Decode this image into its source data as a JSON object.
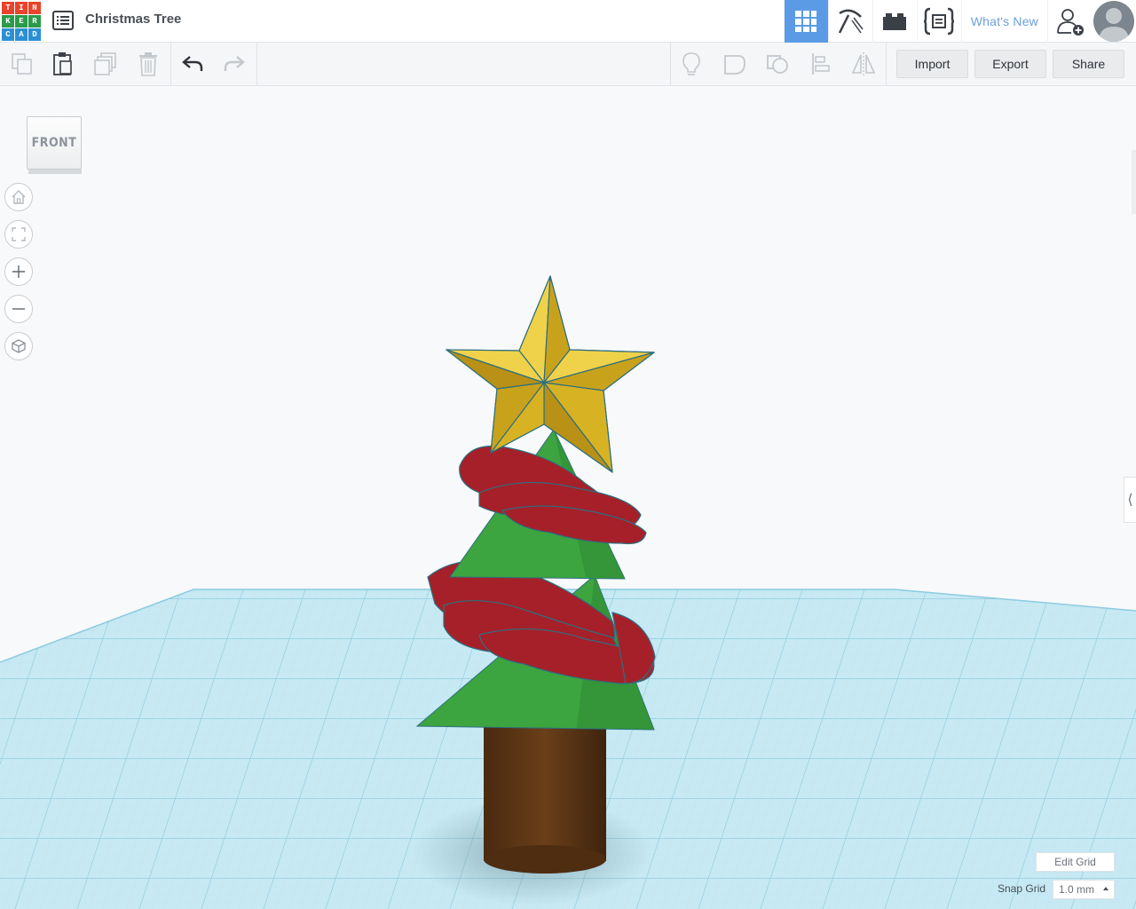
{
  "app": {
    "logo_letters": [
      "T",
      "I",
      "N",
      "K",
      "E",
      "R",
      "C",
      "A",
      "D"
    ],
    "logo_colors": [
      "#e9432b",
      "#e9432b",
      "#e9432b",
      "#2b9b4a",
      "#2b9b4a",
      "#2b9b4a",
      "#2b8fd6",
      "#2b8fd6",
      "#2b8fd6"
    ],
    "document_title": "Christmas Tree"
  },
  "nav": {
    "views": [
      {
        "icon": "grid-3d-design-icon",
        "active": true
      },
      {
        "icon": "pickaxe-blocks-icon",
        "active": false
      },
      {
        "icon": "bricks-icon",
        "active": false
      },
      {
        "icon": "codeblocks-icon",
        "active": false
      }
    ],
    "whats_new": "What's New"
  },
  "toolbar": {
    "import_label": "Import",
    "export_label": "Export",
    "share_label": "Share"
  },
  "viewcube": {
    "face_label": "FRONT"
  },
  "workplane": {
    "edit_grid_label": "Edit Grid",
    "snap_grid_label": "Snap Grid",
    "snap_grid_value": "1.0 mm"
  },
  "colors": {
    "accent": "#5b9be6",
    "grid": "#a9dcea",
    "star": "#e3c02b",
    "tree": "#3ca540",
    "garland": "#a6202a",
    "trunk": "#5c3514"
  }
}
